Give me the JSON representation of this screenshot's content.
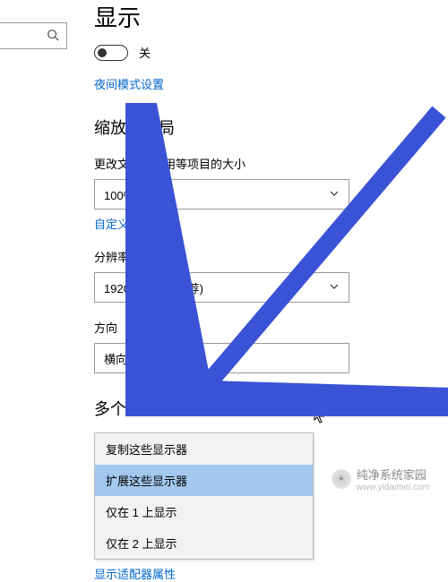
{
  "header": {
    "title": "显示"
  },
  "toggle": {
    "state": "off",
    "label": "关"
  },
  "night_mode_link": "夜间模式设置",
  "scale_section": {
    "heading": "缩放与布局",
    "text_size_label": "更改文本、应用等项目的大小",
    "text_size_value": "100% (推荐)",
    "custom_scale_link": "自定义缩放",
    "resolution_label": "分辨率",
    "resolution_value": "1920 × 1080 (推荐)",
    "orientation_label": "方向",
    "orientation_value": "横向"
  },
  "multi_section": {
    "heading": "多个显示器",
    "options": [
      "复制这些显示器",
      "扩展这些显示器",
      "仅在 1 上显示",
      "仅在 2 上显示"
    ],
    "selected_index": 1,
    "adapter_link": "显示适配器属性"
  },
  "watermark": {
    "brand": "纯净系统家园",
    "url": "www.yidaimei.com"
  }
}
